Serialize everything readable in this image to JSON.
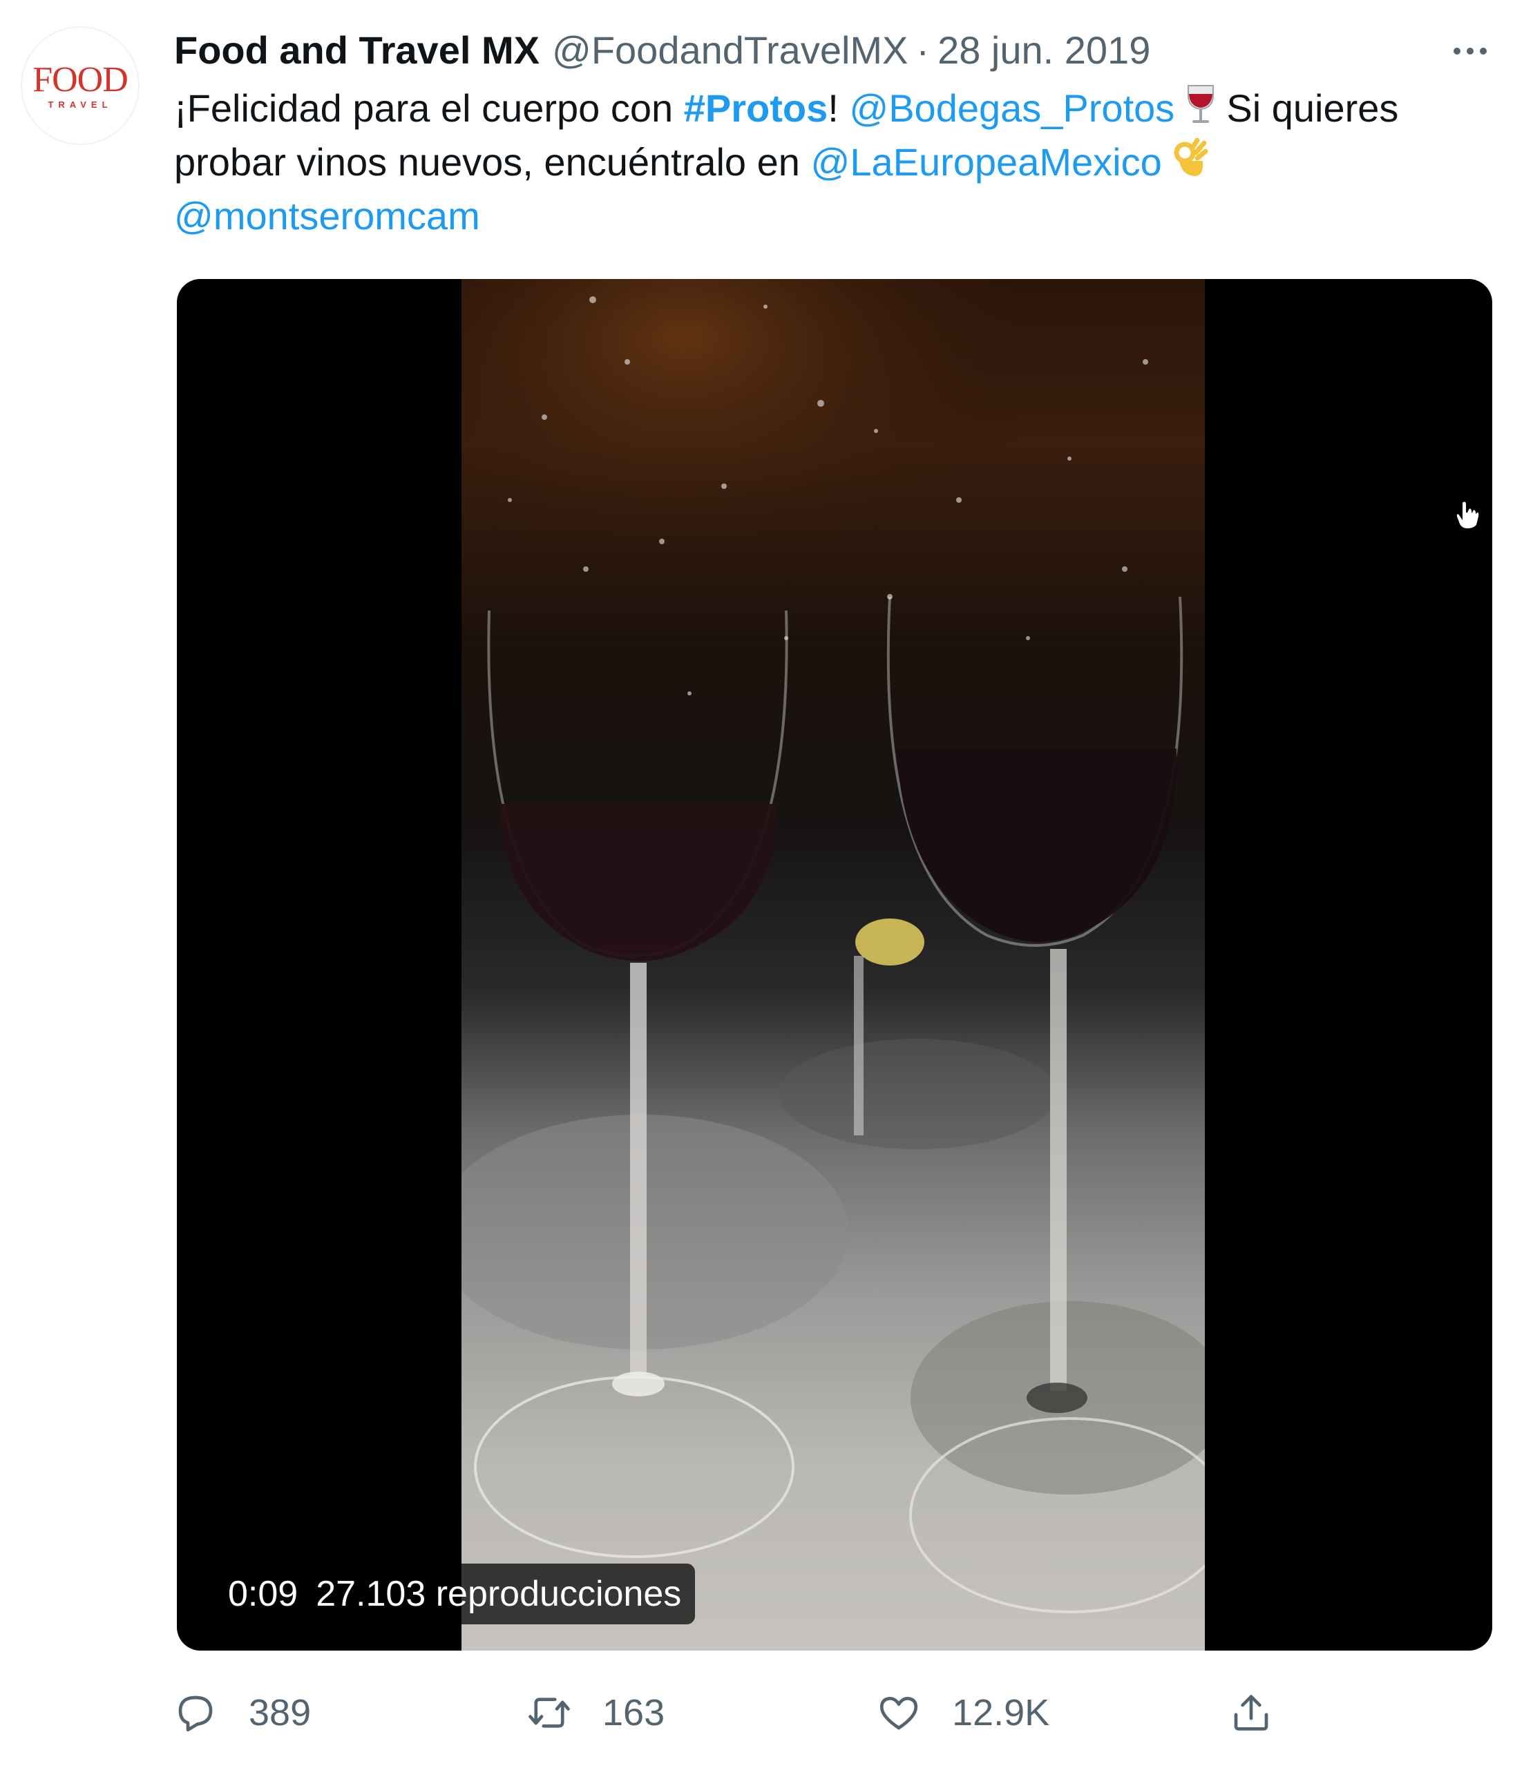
{
  "author": {
    "display_name": "Food and Travel MX",
    "handle": "@FoodandTravelMX",
    "separator": "·",
    "date": "28 jun. 2019",
    "avatar": {
      "logo_main": "FOOD",
      "logo_sub": "TRAVEL",
      "color": "#d3342a"
    }
  },
  "more_menu_icon": "more-horizontal-icon",
  "tweet": {
    "line1_prefix": "¡Felicidad para el cuerpo con ",
    "hashtag": "#Protos",
    "line1_bang": "!",
    "mention_bodegas": "@Bodegas_Protos",
    "wine_emoji": "🍷",
    "line1_suffix": " Si quieres",
    "line2_prefix": "probar vinos nuevos, encuéntralo en ",
    "mention_europea": "@LaEuropeaMexico",
    "ok_emoji": "👌",
    "mention_montse": "@montseromcam"
  },
  "video": {
    "time": "0:09",
    "views": "27.103 reproducciones"
  },
  "actions": {
    "reply_count": "389",
    "retweet_count": "163",
    "like_count": "12.9K",
    "reply_icon": "reply-icon",
    "retweet_icon": "retweet-icon",
    "like_icon": "heart-icon",
    "share_icon": "share-icon"
  },
  "colors": {
    "link": "#1d9bf0",
    "secondary_text": "#536471",
    "primary_text": "#0f1419"
  }
}
